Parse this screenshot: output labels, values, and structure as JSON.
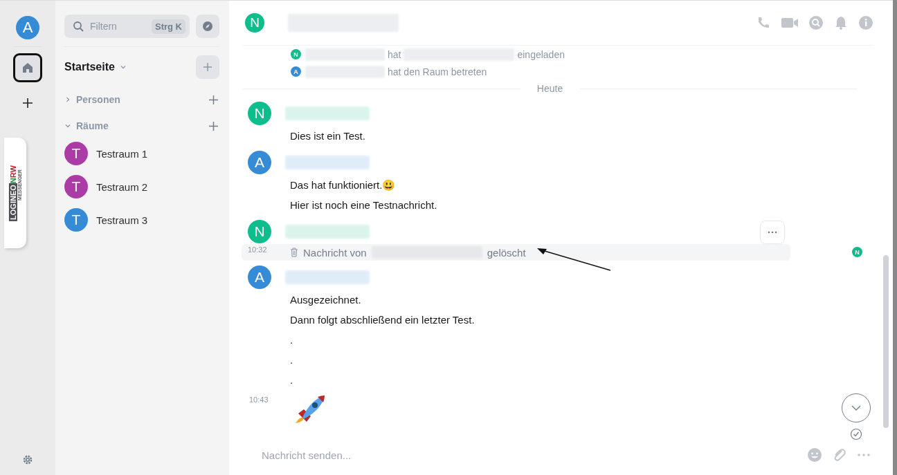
{
  "user_avatar": {
    "letter": "A",
    "color": "#368bd6"
  },
  "rail": {
    "home_selected": true
  },
  "logo": {
    "word": "LOGINEO",
    "accent": "N",
    "accent2": "RW",
    "sub": "MESSENGER"
  },
  "search": {
    "placeholder": "Filtern",
    "shortcut": "Strg K"
  },
  "home": {
    "title": "Startseite"
  },
  "sections": [
    {
      "label": "Personen",
      "expanded": false
    },
    {
      "label": "Räume",
      "expanded": true,
      "rooms": [
        {
          "letter": "T",
          "name": "Testraum 1",
          "color": "#ac3ba8"
        },
        {
          "letter": "T",
          "name": "Testraum 2",
          "color": "#ac3ba8"
        },
        {
          "letter": "T",
          "name": "Testraum 3",
          "color": "#368bd6"
        }
      ]
    }
  ],
  "room": {
    "letter": "N",
    "color": "#0dbd8b"
  },
  "events": [
    {
      "letter": "N",
      "color": "#0dbd8b",
      "segments": [
        "hat",
        "eingeladen"
      ]
    },
    {
      "letter": "A",
      "color": "#368bd6",
      "segments": [
        "hat den Raum betreten"
      ]
    }
  ],
  "day_divider": "Heute",
  "groups": [
    {
      "letter": "N",
      "color": "#0dbd8b",
      "lines": [
        {
          "kind": "text",
          "text": "Dies ist ein Test."
        }
      ]
    },
    {
      "letter": "A",
      "color": "#368bd6",
      "lines": [
        {
          "kind": "text",
          "text": "Das hat funktioniert.😃"
        },
        {
          "kind": "text",
          "text": "Hier ist noch eine Testnachricht."
        }
      ]
    },
    {
      "letter": "N",
      "color": "#0dbd8b",
      "lines": [
        {
          "kind": "deleted",
          "time": "10:32",
          "before": "Nachricht von",
          "after": "gelöscht",
          "receipt": "N",
          "hovered": true
        }
      ]
    },
    {
      "letter": "A",
      "color": "#368bd6",
      "lines": [
        {
          "kind": "text",
          "text": "Ausgezeichnet."
        },
        {
          "kind": "text",
          "text": "Dann folgt abschließend ein letzter Test."
        },
        {
          "kind": "text",
          "text": "."
        },
        {
          "kind": "text",
          "text": "."
        },
        {
          "kind": "text",
          "text": "."
        },
        {
          "kind": "rocket",
          "time": "10:43"
        }
      ]
    }
  ],
  "composer": {
    "placeholder": "Nachricht senden..."
  }
}
